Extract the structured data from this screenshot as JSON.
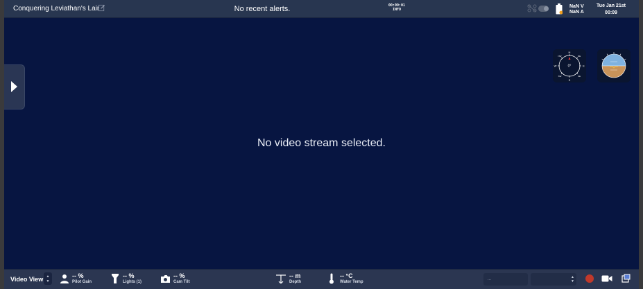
{
  "header": {
    "mission_name": "Conquering Leviathan's Lair",
    "alerts_text": "No recent alerts.",
    "log_time": "00:09:01",
    "log_level": "INFO",
    "voltage": "NaN V",
    "current": "NaN A",
    "date": "Tue Jan 21st",
    "time": "00:09"
  },
  "compass": {
    "heading_text": "0°",
    "north": "N",
    "south": "S",
    "east": "E",
    "west": "W",
    "ne": "NE",
    "nw": "NW",
    "se": "SE",
    "sw": "SW"
  },
  "main": {
    "no_video_text": "No video stream selected."
  },
  "bottom": {
    "view_label": "Video View",
    "pilot_gain_value": "-- %",
    "pilot_gain_label": "Pilot Gain",
    "lights_value": "-- %",
    "lights_label": "Lights (1)",
    "cam_tilt_value": "-- %",
    "cam_tilt_label": "Cam Tilt",
    "depth_value": "-- m",
    "depth_label": "Depth",
    "water_temp_value": "-- °C",
    "water_temp_label": "Water Temp",
    "combo_placeholder": "..."
  },
  "colors": {
    "background": "#071541",
    "bars": "#283650",
    "record": "#c0392b",
    "sky": "#7fb2e0",
    "ground": "#c8935a"
  }
}
